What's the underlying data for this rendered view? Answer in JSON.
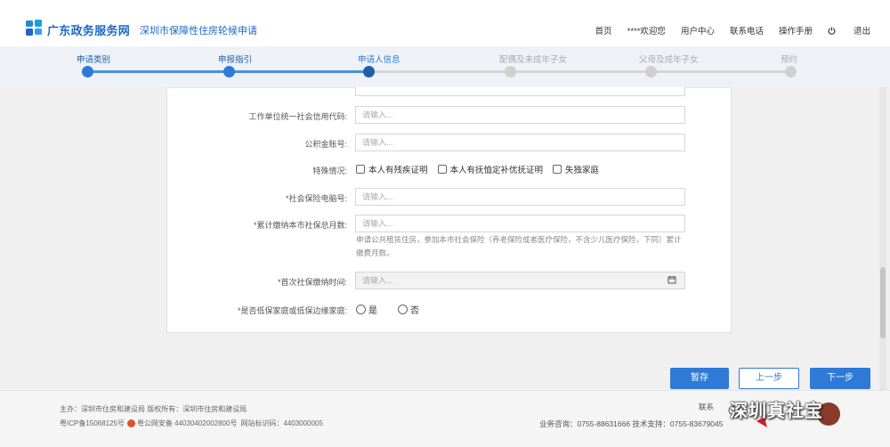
{
  "header": {
    "brand": "广东政务服务网",
    "subtitle": "深圳市保障性住房轮候申请",
    "nav": [
      "首页",
      "****欢迎您",
      "用户中心",
      "联系电话",
      "操作手册"
    ],
    "logout": "退出"
  },
  "steps": [
    {
      "label": "申请类别",
      "state": "done"
    },
    {
      "label": "申报指引",
      "state": "done"
    },
    {
      "label": "申请人信息",
      "state": "active"
    },
    {
      "label": "配偶及未成年子女",
      "state": "pending"
    },
    {
      "label": "父母及成年子女",
      "state": "pending"
    },
    {
      "label": "预约",
      "state": "pending"
    }
  ],
  "form": {
    "credit_code": {
      "label": "工作单位统一社会信用代码:",
      "placeholder": "请输入..."
    },
    "fund_account": {
      "label": "公积金账号:",
      "placeholder": "请输入..."
    },
    "special": {
      "label": "特殊情况:",
      "options": [
        "本人有残疾证明",
        "本人有抚恤定补优抚证明",
        "失独家庭"
      ]
    },
    "social_security_no": {
      "label": "*社会保险电脑号:",
      "placeholder": "请输入..."
    },
    "months": {
      "label": "*累计缴纳本市社保总月数:",
      "placeholder": "请输入...",
      "hint": "申请公共租赁住房，参加本市社会保险（养老保险或者医疗保险，不含少儿医疗保险，下同）累计缴费月数。"
    },
    "first_time": {
      "label": "*首次社保缴纳时间:",
      "placeholder": "请输入..."
    },
    "low_income": {
      "label": "*是否低保家庭或低保边缘家庭:",
      "options": [
        "是",
        "否"
      ]
    }
  },
  "buttons": {
    "save": "暂存",
    "prev": "上一步",
    "next": "下一步"
  },
  "footer": {
    "line1": "主办：深圳市住房和建设局  版权所有：深圳市住房和建设局",
    "icp": "粤ICP备15068125号",
    "police": "粤公网安备 44030402002800号",
    "site_code": "网站标识码：4403000005",
    "contact": "联系",
    "consult": "业务咨询：0755-88631666  技术支持：0755-83679045"
  },
  "watermark": "深圳真社宝",
  "colors": {
    "accent": "#2e7ad6",
    "brand": "#1f69c3",
    "step_done": "#4a90d9",
    "step_pending": "#d0d0d0"
  }
}
